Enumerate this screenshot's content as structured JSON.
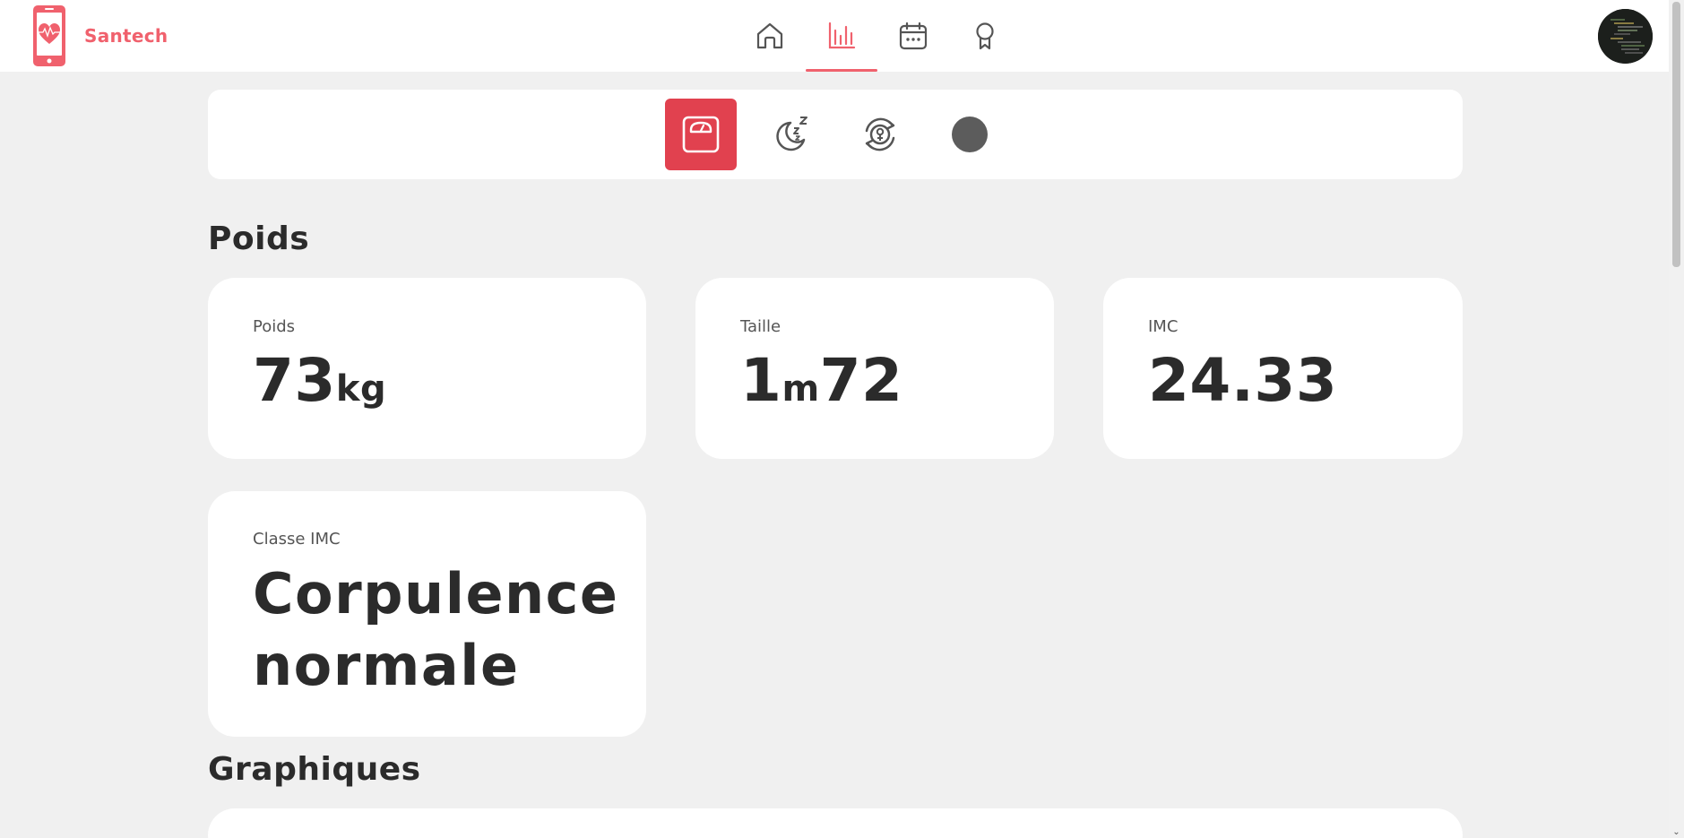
{
  "brand": {
    "name": "Santech"
  },
  "nav": {
    "active": "stats"
  },
  "subnav": {
    "active": "weight"
  },
  "weight_section": {
    "title": "Poids",
    "cards": {
      "weight": {
        "label": "Poids",
        "value": "73",
        "unit": "kg"
      },
      "height": {
        "label": "Taille",
        "value_a": "1",
        "unit": "m",
        "value_b": "72"
      },
      "bmi": {
        "label": "IMC",
        "value": "24.33"
      },
      "bmi_class": {
        "label": "Classe IMC",
        "line1": "Corpulence",
        "line2": "normale"
      }
    }
  },
  "graphs_section": {
    "title": "Graphiques"
  },
  "colors": {
    "accent": "#f0616d",
    "active_tile": "#e1414f",
    "background": "#f0f0f0",
    "text": "#2b2b2b"
  },
  "icons": [
    "phone-heart-logo-icon",
    "home-icon",
    "bar-chart-icon",
    "calendar-icon",
    "award-ribbon-icon",
    "scale-icon",
    "sleep-moon-icon",
    "cycle-female-icon",
    "circle-icon",
    "user-avatar"
  ]
}
